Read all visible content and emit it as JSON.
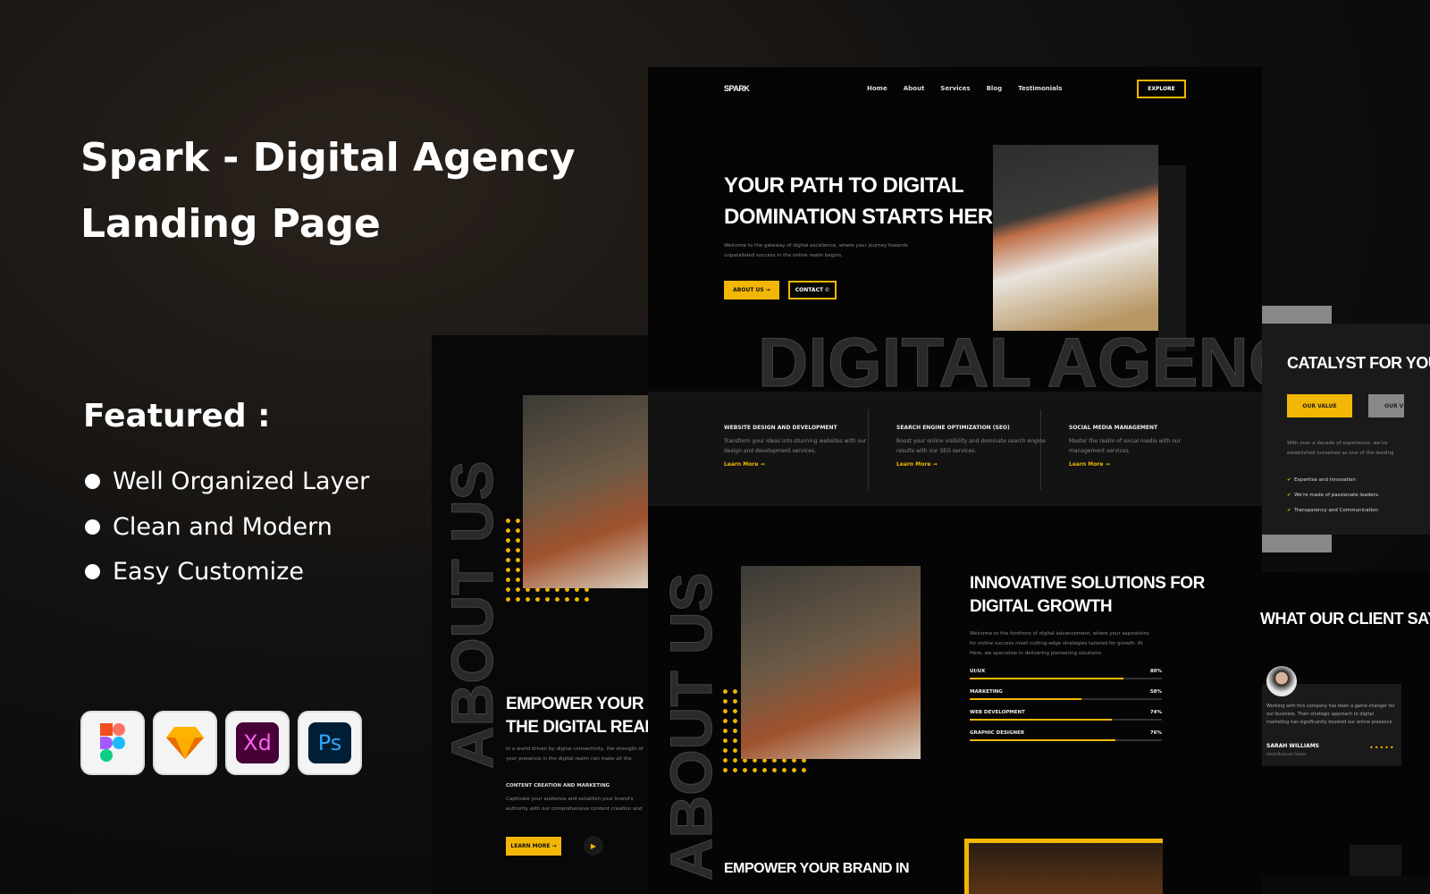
{
  "promo": {
    "title_line1": "Spark - Digital Agency",
    "title_line2": "Landing Page",
    "featured": "Featured :",
    "features": [
      "Well Organized Layer",
      "Clean and Modern",
      "Easy Customize"
    ],
    "tools": [
      {
        "name": "figma-icon"
      },
      {
        "name": "sketch-icon"
      },
      {
        "name": "xd-icon",
        "label": "Xd"
      },
      {
        "name": "photoshop-icon",
        "label": "Ps"
      }
    ]
  },
  "accent": "#f2b705",
  "site": {
    "logo": "SPARK",
    "nav": [
      "Home",
      "About",
      "Services",
      "Blog",
      "Testimonials"
    ],
    "explore": "EXPLORE",
    "hero": {
      "title1": "YOUR PATH TO DIGITAL",
      "title2": "DOMINATION STARTS HERE",
      "text1": "Welcome to the gateway of digital excellence, where your journey towards",
      "text2": "unparalleled success in the online realm begins.",
      "about": "ABOUT US",
      "contact": "CONTACT"
    },
    "watermark": "DIGITAL AGENCY",
    "services": [
      {
        "title": "WEBSITE DESIGN AND DEVELOPMENT",
        "text": "Transform your ideas into stunning websites with our design and development services.",
        "link": "Learn More"
      },
      {
        "title": "SEARCH ENGINE OPTIMIZATION (SEO)",
        "text": "Boost your online visibility and dominate search engine results with our SEO services.",
        "link": "Learn More"
      },
      {
        "title": "SOCIAL MEDIA MANAGEMENT",
        "text": "Master the realm of social media with our management services.",
        "link": "Learn More"
      }
    ],
    "about_watermark": "ABOUT US",
    "innov": {
      "title1": "INNOVATIVE SOLUTIONS FOR",
      "title2": "DIGITAL GROWTH",
      "text": "Welcome to the forefront of digital advancement, where your aspirations for online success meet cutting-edge strategies tailored for growth. At Here, we specialize in delivering pioneering solutions.",
      "skills": [
        {
          "label": "UI/UX",
          "pct": 80,
          "text": "80%"
        },
        {
          "label": "MARKETING",
          "pct": 58,
          "text": "58%"
        },
        {
          "label": "WEB DEVELOPMENT",
          "pct": 74,
          "text": "74%"
        },
        {
          "label": "GRAPHIC DESIGNER",
          "pct": 76,
          "text": "76%"
        }
      ]
    },
    "empower": {
      "title1": "EMPOWER YOUR BRAND IN",
      "title2": "THE DIGITAL REALM",
      "text": "In a world driven by digital connectivity, the strength of your presence in the digital realm can make all the difference.",
      "sub": "CONTENT CREATION AND MARKETING",
      "subtext": "Captivate your audience and establish your brand's authority with our comprehensive content creation and marketing services.",
      "learn": "LEARN MORE",
      "bottom_title": "EMPOWER YOUR BRAND IN"
    },
    "catalyst": {
      "title": "CATALYST FOR YOUR",
      "tab1": "OUR VALUE",
      "tab2": "OUR V",
      "text": "With over a decade of experience, we've established ourselves as one of the leading agencies in the region.",
      "checks": [
        "Expertise and Innovation",
        "We're made of passionate leaders.",
        "Transparency and Communication"
      ]
    },
    "testimonial": {
      "title": "WHAT OUR CLIENT SAYS",
      "quote": "Working with this company has been a game-changer for our business. Their strategic approach to digital marketing has significantly boosted our online presence",
      "name": "SARAH WILLIAMS",
      "role": "Small Business Owner"
    }
  }
}
